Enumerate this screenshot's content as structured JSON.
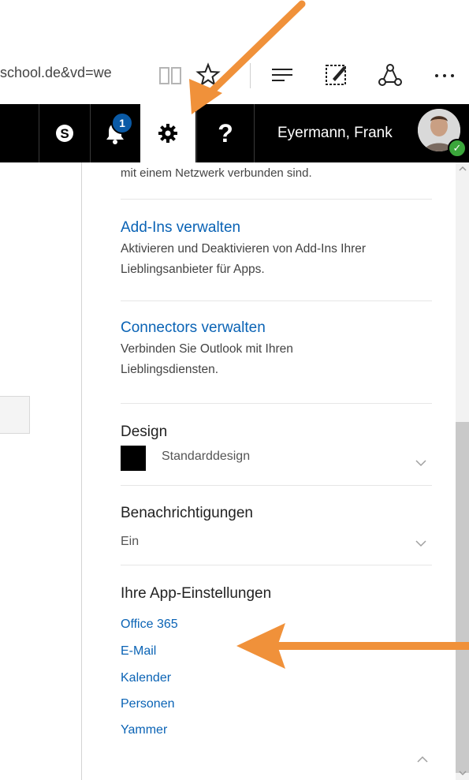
{
  "browser": {
    "url_fragment": "school.de&vd=we"
  },
  "header": {
    "notification_count": "1",
    "help_label": "?",
    "user_name": "Eyermann, Frank"
  },
  "panel": {
    "top_desc": "mit einem Netzwerk verbunden sind.",
    "addins": {
      "title": "Add-Ins verwalten",
      "desc": "Aktivieren und Deaktivieren von Add-Ins Ihrer Lieblingsanbieter für Apps."
    },
    "connectors": {
      "title": "Connectors verwalten",
      "desc": "Verbinden Sie Outlook mit Ihren Lieblingsdiensten."
    },
    "design": {
      "title": "Design",
      "value": "Standarddesign",
      "swatch_color": "#000000"
    },
    "notifications": {
      "title": "Benachrichtigungen",
      "value": "Ein"
    },
    "app_settings": {
      "title": "Ihre App-Einstellungen",
      "links": [
        "Office 365",
        "E-Mail",
        "Kalender",
        "Personen",
        "Yammer"
      ]
    }
  },
  "colors": {
    "link": "#0a63b5",
    "header_bg": "#000000",
    "arrow": "#f0913a"
  }
}
